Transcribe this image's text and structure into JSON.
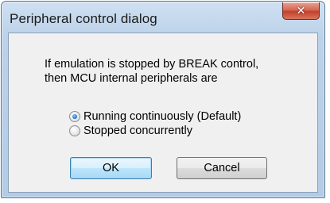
{
  "window": {
    "title": "Peripheral control dialog",
    "close_icon": "close-x-icon"
  },
  "dialog": {
    "message_line1": "If emulation is stopped by BREAK control,",
    "message_line2": "then MCU internal peripherals are",
    "options": [
      {
        "label": "Running continuously (Default)",
        "checked": true
      },
      {
        "label": "Stopped concurrently",
        "checked": false
      }
    ],
    "ok_label": "OK",
    "cancel_label": "Cancel"
  },
  "colors": {
    "accent": "#3c7fb1",
    "titlebar": "#bcd2ea",
    "close_button": "#c3402a"
  }
}
